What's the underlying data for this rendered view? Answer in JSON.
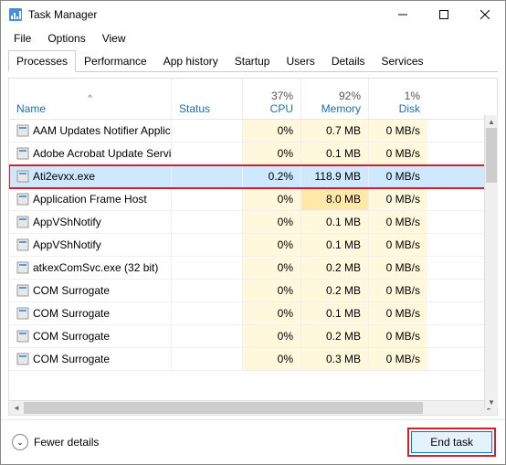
{
  "window": {
    "title": "Task Manager"
  },
  "menu": {
    "file": "File",
    "options": "Options",
    "view": "View"
  },
  "tabs": {
    "processes": "Processes",
    "performance": "Performance",
    "app_history": "App history",
    "startup": "Startup",
    "users": "Users",
    "details": "Details",
    "services": "Services"
  },
  "columns": {
    "name": "Name",
    "status": "Status",
    "cpu": {
      "value": "37%",
      "label": "CPU"
    },
    "memory": {
      "value": "92%",
      "label": "Memory"
    },
    "disk": {
      "value": "1%",
      "label": "Disk"
    }
  },
  "rows": [
    {
      "name": "AAM Updates Notifier Applicati...",
      "cpu": "0%",
      "mem": "0.7 MB",
      "disk": "0 MB/s"
    },
    {
      "name": "Adobe Acrobat Update Service (...",
      "cpu": "0%",
      "mem": "0.1 MB",
      "disk": "0 MB/s"
    },
    {
      "name": "Ati2evxx.exe",
      "cpu": "0.2%",
      "mem": "118.9 MB",
      "disk": "0 MB/s",
      "selected": true,
      "highlighted": true
    },
    {
      "name": "Application Frame Host",
      "cpu": "0%",
      "mem": "8.0 MB",
      "disk": "0 MB/s"
    },
    {
      "name": "AppVShNotify",
      "cpu": "0%",
      "mem": "0.1 MB",
      "disk": "0 MB/s"
    },
    {
      "name": "AppVShNotify",
      "cpu": "0%",
      "mem": "0.1 MB",
      "disk": "0 MB/s"
    },
    {
      "name": "atkexComSvc.exe (32 bit)",
      "cpu": "0%",
      "mem": "0.2 MB",
      "disk": "0 MB/s"
    },
    {
      "name": "COM Surrogate",
      "cpu": "0%",
      "mem": "0.2 MB",
      "disk": "0 MB/s"
    },
    {
      "name": "COM Surrogate",
      "cpu": "0%",
      "mem": "0.1 MB",
      "disk": "0 MB/s"
    },
    {
      "name": "COM Surrogate",
      "cpu": "0%",
      "mem": "0.2 MB",
      "disk": "0 MB/s"
    },
    {
      "name": "COM Surrogate",
      "cpu": "0%",
      "mem": "0.3 MB",
      "disk": "0 MB/s"
    }
  ],
  "footer": {
    "fewer": "Fewer details",
    "end_task": "End task"
  }
}
